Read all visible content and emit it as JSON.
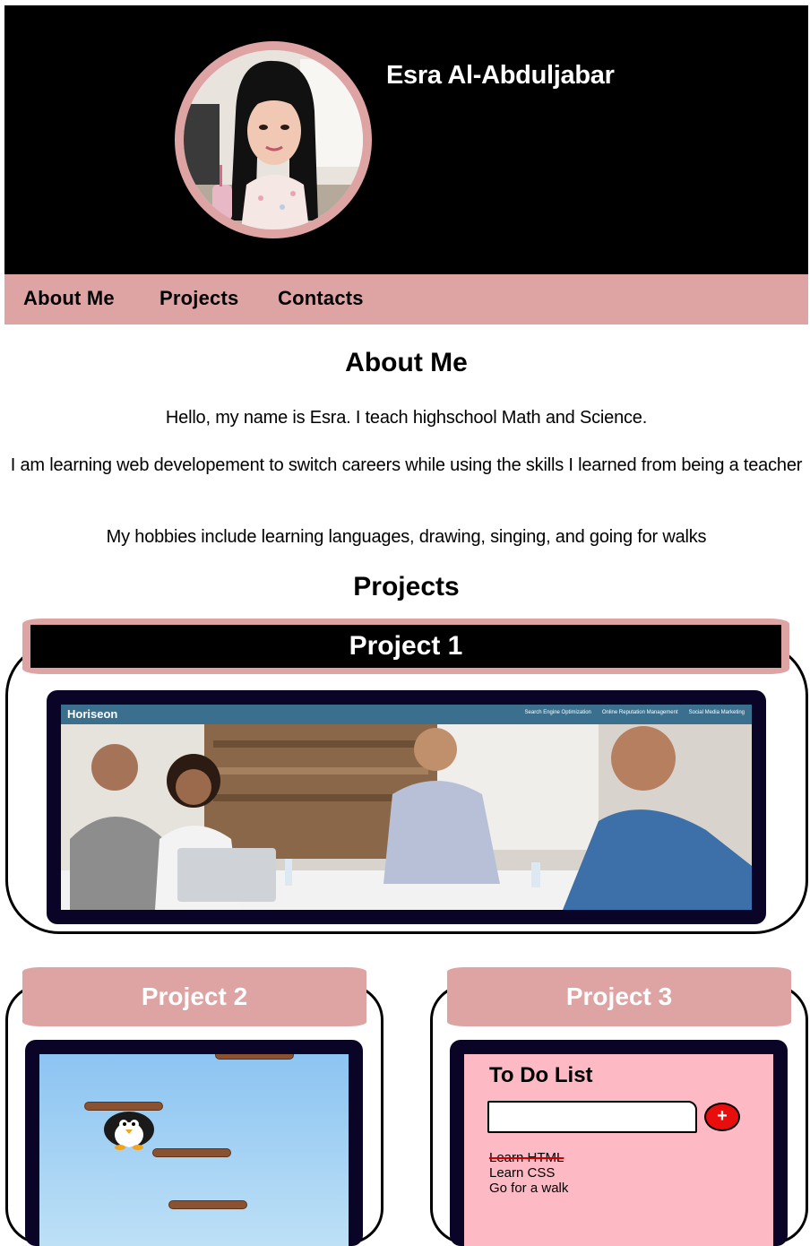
{
  "header": {
    "name": "Esra Al-Abduljabar"
  },
  "nav": {
    "items": [
      {
        "label": "About Me"
      },
      {
        "label": "Projects"
      },
      {
        "label": "Contacts"
      }
    ]
  },
  "about": {
    "title": "About Me",
    "paragraphs": [
      "Hello, my name is Esra. I teach highschool Math and Science.",
      "I am learning web developement to switch careers while using the skills I learned from being a teacher",
      "My hobbies include learning languages, drawing, singing, and going for walks"
    ]
  },
  "projects": {
    "title": "Projects",
    "items": [
      {
        "label": "Project 1",
        "preview": {
          "logo": "Horiseon",
          "links": [
            "Search Engine Optimization",
            "Online Reputation Management",
            "Social Media Marketing"
          ]
        }
      },
      {
        "label": "Project 2"
      },
      {
        "label": "Project 3",
        "preview": {
          "title": "To Do List",
          "add_button": "+",
          "items": [
            {
              "text": "Learn HTML",
              "done": true
            },
            {
              "text": "Learn CSS",
              "done": false
            },
            {
              "text": "Go for a walk",
              "done": false
            }
          ]
        }
      }
    ]
  },
  "colors": {
    "accent_pink": "#dea3a3",
    "header_bg": "#000000",
    "frame_navy": "#0a0526",
    "todo_pink": "#fdbac5",
    "add_red": "#e80e0e"
  }
}
